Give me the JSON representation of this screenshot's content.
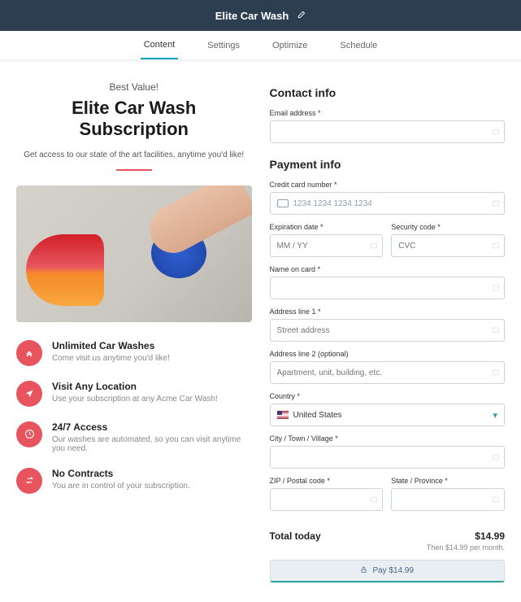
{
  "topbar": {
    "title": "Elite Car Wash"
  },
  "tabs": {
    "items": [
      "Content",
      "Settings",
      "Optimize",
      "Schedule"
    ]
  },
  "hero": {
    "eyebrow": "Best Value!",
    "title_l1": "Elite Car Wash",
    "title_l2": "Subscription",
    "subtitle": "Get access to our state of the art facilities, anytime you'd like!"
  },
  "features": [
    {
      "title": "Unlimited Car Washes",
      "desc": "Come visit us anytime you'd like!",
      "icon": "chevrons-up-icon"
    },
    {
      "title": "Visit Any Location",
      "desc": "Use your subscription at any Acme Car Wash!",
      "icon": "arrow-icon"
    },
    {
      "title": "24/7 Access",
      "desc": "Our washes are automated, so you can visit anytime you need.",
      "icon": "clock-icon"
    },
    {
      "title": "No Contracts",
      "desc": "You are in control of your subscription.",
      "icon": "swap-icon"
    }
  ],
  "contact": {
    "heading": "Contact info",
    "email_label": "Email address *"
  },
  "payment": {
    "heading": "Payment info",
    "cc_label": "Credit card number *",
    "cc_placeholder": "1234 1234 1234 1234",
    "exp_label": "Expiration date *",
    "exp_placeholder": "MM / YY",
    "cvc_label": "Security code *",
    "cvc_placeholder": "CVC",
    "name_label": "Name on card *",
    "addr1_label": "Address line 1 *",
    "addr1_placeholder": "Street address",
    "addr2_label": "Address line 2 (optional)",
    "addr2_placeholder": "Apartment, unit, building, etc.",
    "country_label": "Country *",
    "country_value": "United States",
    "city_label": "City / Town / Village *",
    "zip_label": "ZIP / Postal code *",
    "state_label": "State / Province *"
  },
  "totals": {
    "label": "Total today",
    "amount": "$14.99",
    "recurring": "Then $14.99 per month.",
    "pay_button": "Pay $14.99"
  }
}
